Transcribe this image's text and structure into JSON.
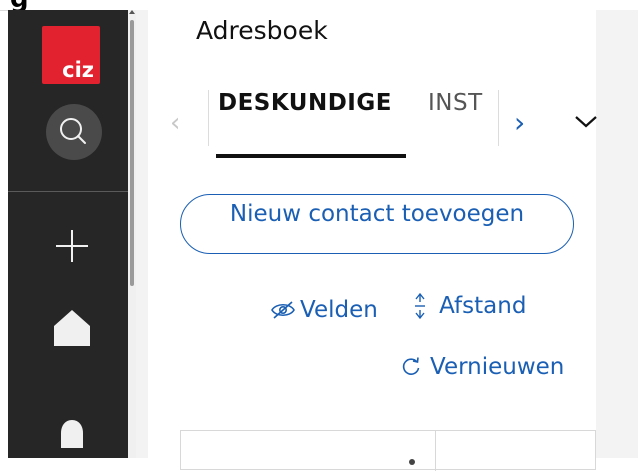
{
  "top_heading_partial": "g",
  "brand": {
    "logo_text": "ciz",
    "logo_color": "#e2222e"
  },
  "page": {
    "title": "Adresboek"
  },
  "tabs": {
    "active_label": "DESKUNDIGE",
    "inactive_label": "INST",
    "prev_glyph": "‹",
    "next_glyph": "›"
  },
  "actions": {
    "new_contact_label": "Nieuw contact toevoegen",
    "fields_label": "Velden",
    "spacing_label": "Afstand",
    "refresh_label": "Vernieuwen"
  },
  "colors": {
    "accent": "#1a5fb4",
    "sidebar_bg": "#262626",
    "text": "#111111"
  },
  "icons": [
    "search-icon",
    "plus-icon",
    "home-icon",
    "bell-icon",
    "eye-off-icon",
    "spacing-icon",
    "refresh-icon",
    "chevron-down-icon"
  ]
}
